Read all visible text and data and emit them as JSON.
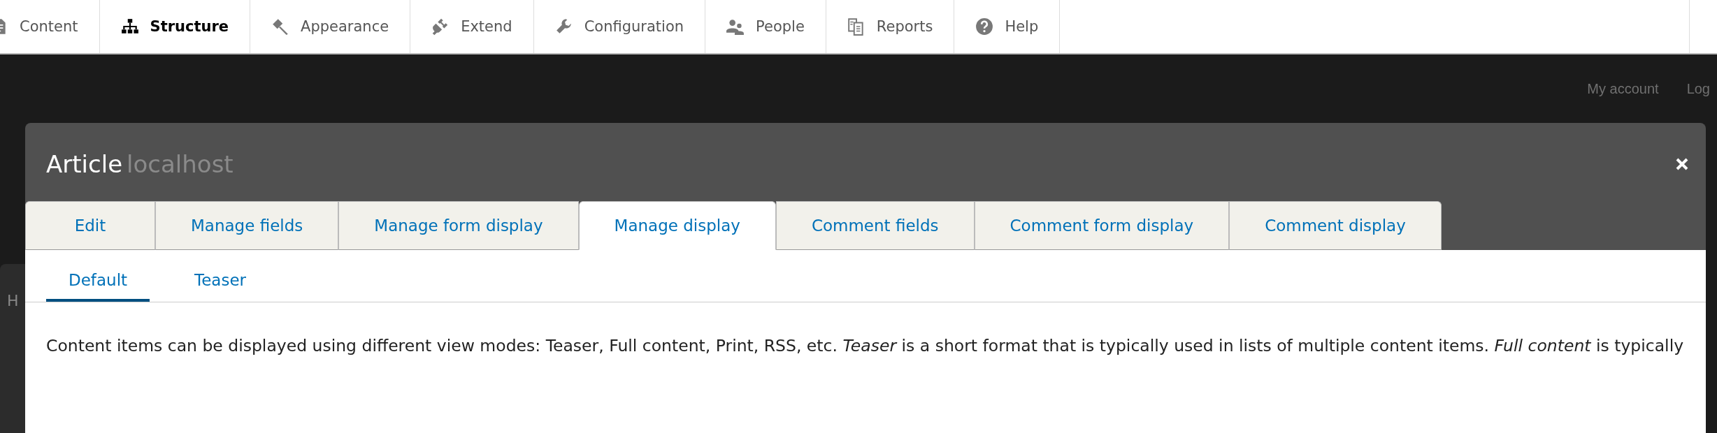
{
  "toolbar": {
    "items": [
      {
        "label": "Content",
        "kind": "content",
        "selected": false
      },
      {
        "label": "Structure",
        "kind": "structure",
        "selected": true
      },
      {
        "label": "Appearance",
        "kind": "appearance",
        "selected": false
      },
      {
        "label": "Extend",
        "kind": "extend",
        "selected": false
      },
      {
        "label": "Configuration",
        "kind": "configuration",
        "selected": false
      },
      {
        "label": "People",
        "kind": "people",
        "selected": false
      },
      {
        "label": "Reports",
        "kind": "reports",
        "selected": false
      },
      {
        "label": "Help",
        "kind": "help",
        "selected": false
      }
    ]
  },
  "background": {
    "account_links": [
      "My account",
      "Log"
    ],
    "site_name": "localhost",
    "page_letter": "H"
  },
  "dialog": {
    "title": "Article",
    "tabs": [
      {
        "label": "Edit",
        "selected": false
      },
      {
        "label": "Manage fields",
        "selected": false
      },
      {
        "label": "Manage form display",
        "selected": false
      },
      {
        "label": "Manage display",
        "selected": true
      },
      {
        "label": "Comment fields",
        "selected": false
      },
      {
        "label": "Comment form display",
        "selected": false
      },
      {
        "label": "Comment display",
        "selected": false
      }
    ],
    "secondary_tabs": [
      {
        "label": "Default",
        "selected": true
      },
      {
        "label": "Teaser",
        "selected": false
      }
    ],
    "description": "Content items can be displayed using different view modes: Teaser, Full content, Print, RSS, etc. *Teaser* is a short format that is typically used in lists of multiple content items. *Full content* is typically"
  }
}
